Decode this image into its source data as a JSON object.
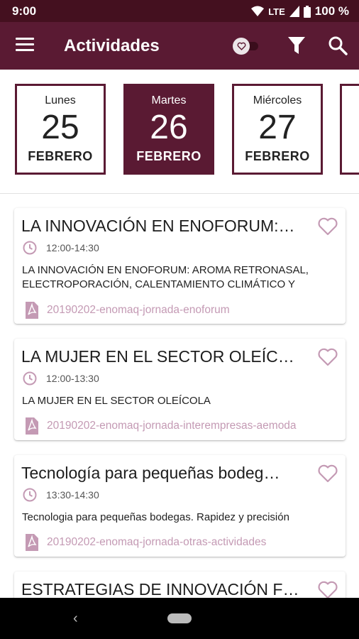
{
  "status": {
    "time": "9:00",
    "network": "LTE",
    "battery": "100 %"
  },
  "appbar": {
    "title": "Actividades"
  },
  "days": [
    {
      "name": "Lunes",
      "number": "25",
      "month": "FEBRERO",
      "selected": false
    },
    {
      "name": "Martes",
      "number": "26",
      "month": "FEBRERO",
      "selected": true
    },
    {
      "name": "Miércoles",
      "number": "27",
      "month": "FEBRERO",
      "selected": false
    }
  ],
  "activities": [
    {
      "title": "LA INNOVACIÓN EN ENOFORUM:…",
      "time": "12:00-14:30",
      "description": "LA INNOVACIÓN EN ENOFORUM: AROMA RETRONASAL, ELECTROPORACIÓN, CALENTAMIENTO CLIMÁTICO Y",
      "file": "20190202-enomaq-jornada-enoforum"
    },
    {
      "title": "LA MUJER EN EL SECTOR OLEÍC…",
      "time": "12:00-13:30",
      "description": "LA MUJER EN EL SECTOR OLEÍCOLA",
      "file": "20190202-enomaq-jornada-interempresas-aemoda"
    },
    {
      "title": "Tecnología para pequeñas bodeg…",
      "time": "13:30-14:30",
      "description": "Tecnologia para pequeñas bodegas. Rapidez y precisión",
      "file": "20190202-enomaq-jornada-otras-actividades"
    },
    {
      "title": "ESTRATEGIAS DE INNOVACIÓN F…"
    }
  ],
  "colors": {
    "primary": "#5a1a33",
    "statusbar": "#44101f",
    "accent_pink": "#c49ab4"
  }
}
